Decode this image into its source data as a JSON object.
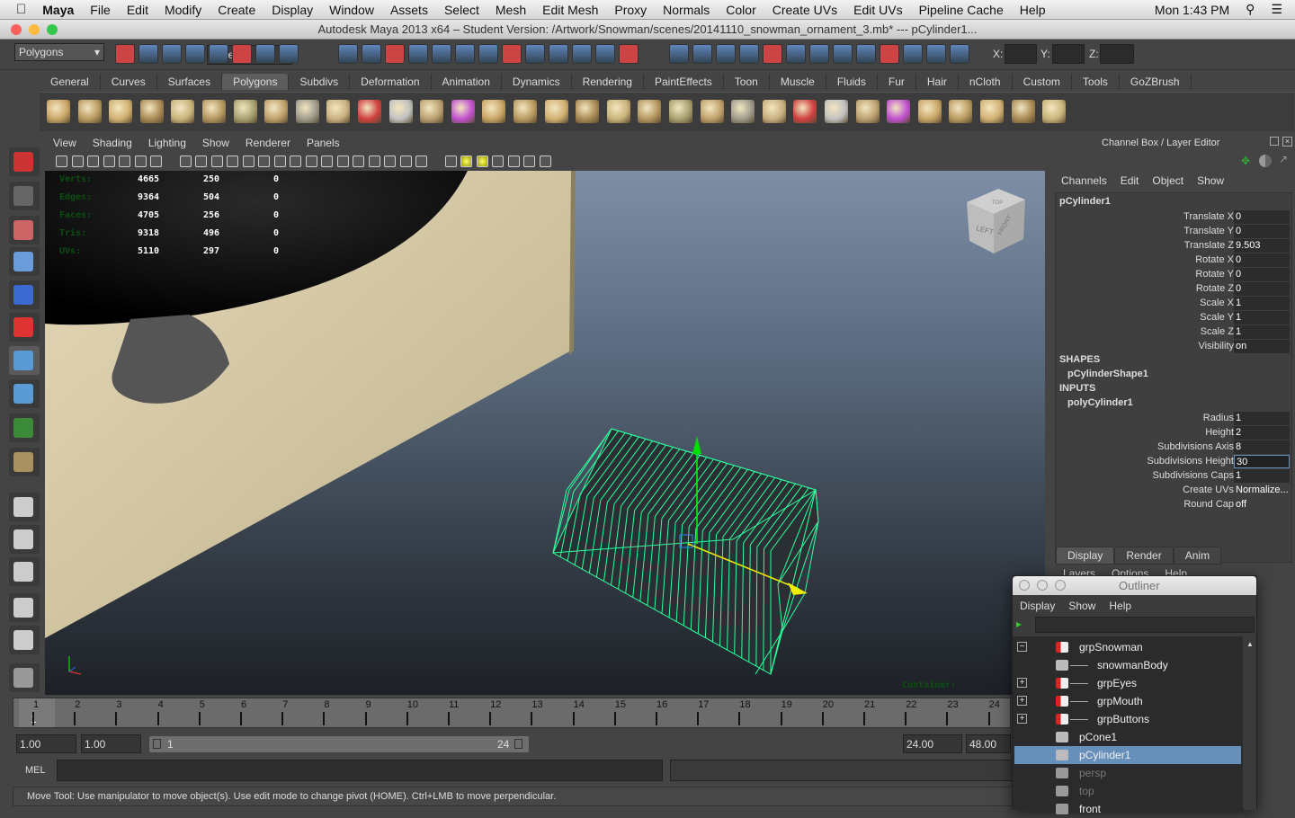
{
  "menubar": {
    "app": "Maya",
    "items": [
      "File",
      "Edit",
      "Modify",
      "Create",
      "Display",
      "Window",
      "Assets",
      "Select",
      "Mesh",
      "Edit Mesh",
      "Proxy",
      "Normals",
      "Color",
      "Create UVs",
      "Edit UVs",
      "Pipeline Cache",
      "Help"
    ],
    "clock": "Mon 1:43 PM"
  },
  "window": {
    "title": "Autodesk Maya 2013 x64 – Student Version: /Artwork/Snowman/scenes/20141110_snowman_ornament_3.mb*   ---    pCylinder1..."
  },
  "status_line": {
    "menu_set": "Polygons",
    "selection_mode": "Objects",
    "x_label": "X:",
    "y_label": "Y:",
    "z_label": "Z:"
  },
  "shelf": {
    "tabs": [
      "General",
      "Curves",
      "Surfaces",
      "Polygons",
      "Subdivs",
      "Deformation",
      "Animation",
      "Dynamics",
      "Rendering",
      "PaintEffects",
      "Toon",
      "Muscle",
      "Fluids",
      "Fur",
      "Hair",
      "nCloth",
      "Custom",
      "Tools",
      "GoZBrush"
    ],
    "active": "Polygons"
  },
  "viewport": {
    "menu": [
      "View",
      "Shading",
      "Lighting",
      "Show",
      "Renderer",
      "Panels"
    ],
    "hud": [
      {
        "label": "Verts:",
        "a": "4665",
        "b": "250",
        "c": "0"
      },
      {
        "label": "Edges:",
        "a": "9364",
        "b": "504",
        "c": "0"
      },
      {
        "label": "Faces:",
        "a": "4705",
        "b": "256",
        "c": "0"
      },
      {
        "label": "Tris:",
        "a": "9318",
        "b": "496",
        "c": "0"
      },
      {
        "label": "UVs:",
        "a": "5110",
        "b": "297",
        "c": "0"
      }
    ],
    "container_label": "Container:",
    "view_cube": {
      "left": "LEFT",
      "front": "FRONT",
      "top": "TOP"
    }
  },
  "channel_box": {
    "title": "Channel Box / Layer Editor",
    "menu": [
      "Channels",
      "Edit",
      "Object",
      "Show"
    ],
    "object": "pCylinder1",
    "attrs": [
      {
        "name": "Translate X",
        "value": "0"
      },
      {
        "name": "Translate Y",
        "value": "0"
      },
      {
        "name": "Translate Z",
        "value": "9.503"
      },
      {
        "name": "Rotate X",
        "value": "0"
      },
      {
        "name": "Rotate Y",
        "value": "0"
      },
      {
        "name": "Rotate Z",
        "value": "0"
      },
      {
        "name": "Scale X",
        "value": "1"
      },
      {
        "name": "Scale Y",
        "value": "1"
      },
      {
        "name": "Scale Z",
        "value": "1"
      },
      {
        "name": "Visibility",
        "value": "on"
      }
    ],
    "shapes_label": "SHAPES",
    "shape": "pCylinderShape1",
    "inputs_label": "INPUTS",
    "input": "polyCylinder1",
    "input_attrs": [
      {
        "name": "Radius",
        "value": "1"
      },
      {
        "name": "Height",
        "value": "2"
      },
      {
        "name": "Subdivisions Axis",
        "value": "8"
      },
      {
        "name": "Subdivisions Height",
        "value": "30"
      },
      {
        "name": "Subdivisions Caps",
        "value": "1"
      },
      {
        "name": "Create UVs",
        "value": "Normalize..."
      },
      {
        "name": "Round Cap",
        "value": "off"
      }
    ],
    "layer_tabs": [
      "Display",
      "Render",
      "Anim"
    ],
    "layer_menu": [
      "Layers",
      "Options",
      "Help"
    ]
  },
  "timeline": {
    "ticks": [
      "1",
      "2",
      "3",
      "4",
      "5",
      "6",
      "7",
      "8",
      "9",
      "10",
      "11",
      "12",
      "13",
      "14",
      "15",
      "16",
      "17",
      "18",
      "19",
      "20",
      "21",
      "22",
      "23",
      "24"
    ],
    "current": "1"
  },
  "range": {
    "start": "1.00",
    "current_start": "1.00",
    "slider_start": "1",
    "slider_end": "24",
    "end": "24.00",
    "anim_end": "48.00"
  },
  "command_line": {
    "label": "MEL"
  },
  "help_line": "Move Tool: Use manipulator to move object(s). Use edit mode to change pivot (HOME).  Ctrl+LMB to move perpendicular.",
  "outliner": {
    "title": "Outliner",
    "menu": [
      "Display",
      "Show",
      "Help"
    ],
    "items": [
      {
        "name": "grpSnowman",
        "type": "group",
        "indent": 0,
        "expander": "-"
      },
      {
        "name": "snowmanBody",
        "type": "mesh",
        "indent": 1
      },
      {
        "name": "grpEyes",
        "type": "group",
        "indent": 1,
        "expander": "+"
      },
      {
        "name": "grpMouth",
        "type": "group",
        "indent": 1,
        "expander": "+"
      },
      {
        "name": "grpButtons",
        "type": "group",
        "indent": 1,
        "expander": "+"
      },
      {
        "name": "pCone1",
        "type": "mesh",
        "indent": 0
      },
      {
        "name": "pCylinder1",
        "type": "mesh",
        "indent": 0,
        "selected": true
      },
      {
        "name": "persp",
        "type": "camera",
        "indent": 0,
        "dim": true
      },
      {
        "name": "top",
        "type": "camera",
        "indent": 0,
        "dim": true
      },
      {
        "name": "front",
        "type": "camera",
        "indent": 0
      }
    ]
  },
  "colors": {
    "selection": "#6690b9",
    "wireframe": "#2dffa0",
    "hud_label": "#0d4d12"
  }
}
